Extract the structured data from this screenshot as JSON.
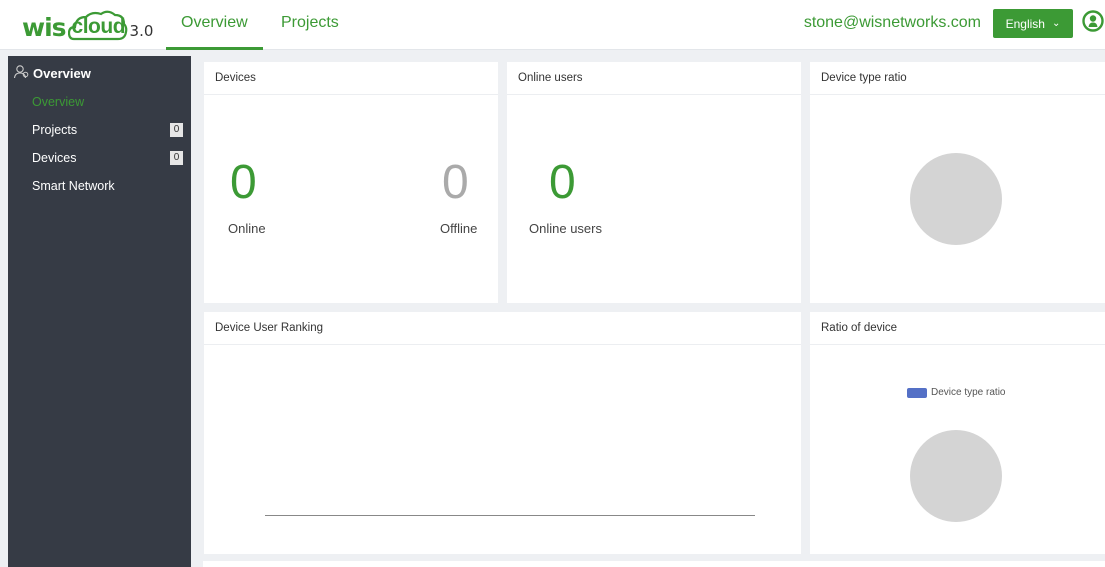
{
  "header": {
    "logo_wis": "wis",
    "logo_cloud": "cloud",
    "logo_version": "3.0",
    "tabs": [
      {
        "label": "Overview",
        "active": true
      },
      {
        "label": "Projects",
        "active": false
      }
    ],
    "user_email": "stone@wisnetworks.com",
    "language": "English",
    "accent_color": "#3c9a35"
  },
  "sidebar": {
    "title": "Overview",
    "items": [
      {
        "label": "Overview",
        "active": true,
        "badge": null
      },
      {
        "label": "Projects",
        "active": false,
        "badge": "0"
      },
      {
        "label": "Devices",
        "active": false,
        "badge": "0"
      },
      {
        "label": "Smart Network",
        "active": false,
        "badge": null
      }
    ]
  },
  "devices_card": {
    "title": "Devices",
    "online_count": "0",
    "online_label": "Online",
    "offline_count": "0",
    "offline_label": "Offline"
  },
  "online_users_card": {
    "title": "Online users",
    "count": "0",
    "label": "Online users"
  },
  "device_type_card": {
    "title": "Device type ratio"
  },
  "ranking_card": {
    "title": "Device User Ranking"
  },
  "ratio_card": {
    "title": "Ratio of device",
    "legend_label": "Device type ratio",
    "legend_color": "#5470c6"
  }
}
